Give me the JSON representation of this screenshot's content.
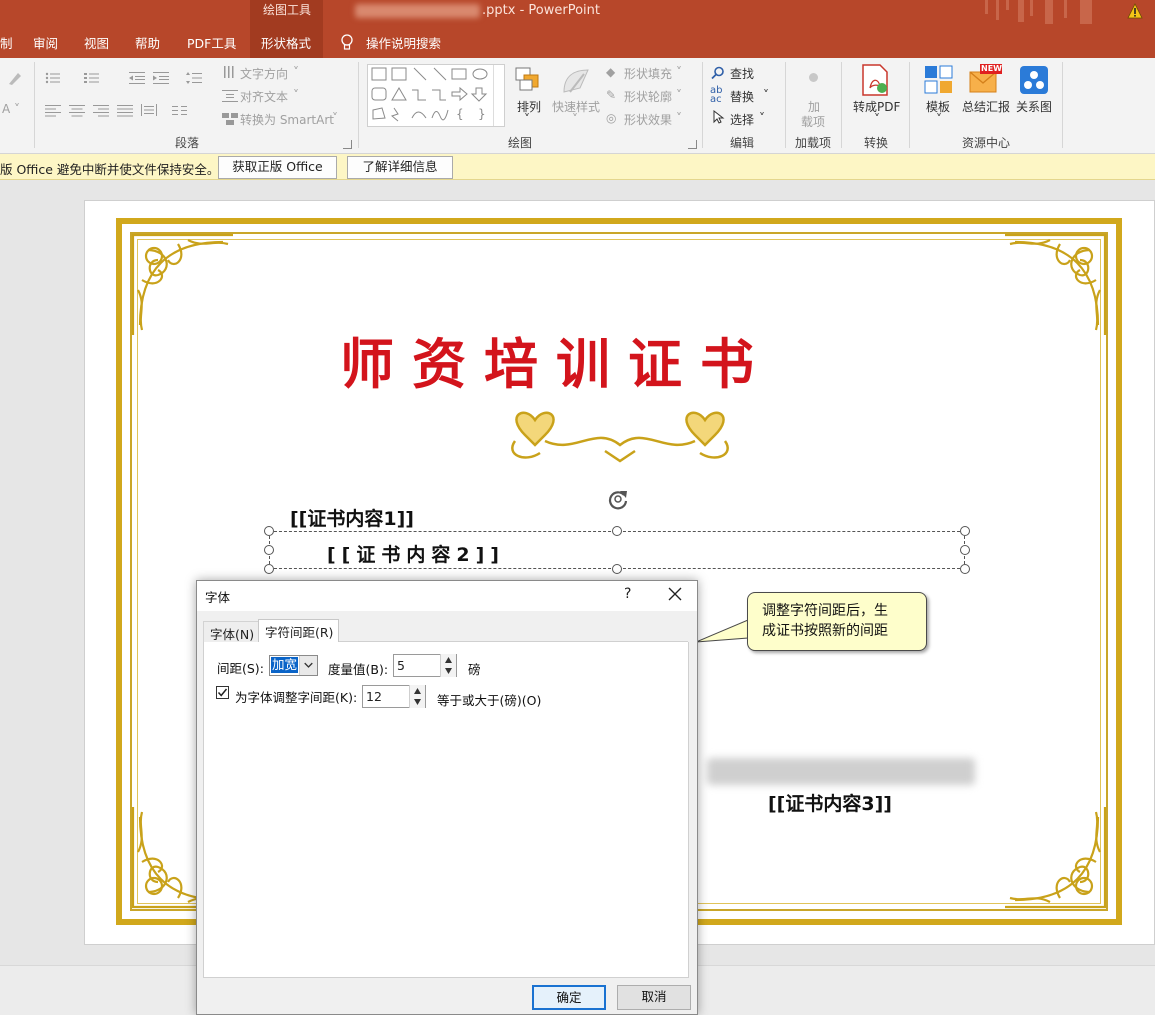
{
  "window": {
    "contextual_group": "绘图工具",
    "filename_suffix": ".pptx",
    "title_sep": "-",
    "app_name": "PowerPoint"
  },
  "tabs": {
    "draw_partial": "制",
    "review": "审阅",
    "view": "视图",
    "help": "帮助",
    "pdf_tools": "PDF工具",
    "shape_format": "形状格式",
    "tell_me": "操作说明搜索"
  },
  "ribbon": {
    "paragraph": {
      "text_direction": "文字方向",
      "align_text": "对齐文本",
      "convert_smartart": "转换为 SmartArt",
      "group_label": "段落"
    },
    "drawing": {
      "arrange": "排列",
      "quick_styles": "快速样式",
      "shape_fill": "形状填充",
      "shape_outline": "形状轮廓",
      "shape_effects": "形状效果",
      "group_label": "绘图"
    },
    "editing": {
      "find": "查找",
      "replace": "替换",
      "select": "选择",
      "group_label": "编辑"
    },
    "addins": {
      "label_line1": "加",
      "label_line2": "载项",
      "group_label": "加载项"
    },
    "convert": {
      "to_pdf": "转成PDF",
      "group_label": "转换"
    },
    "resources": {
      "templates": "模板",
      "summary_report": "总结汇报",
      "relationship": "关系图",
      "new_badge": "NEW",
      "group_label": "资源中心"
    }
  },
  "message_bar": {
    "text": "版 Office 避免中断并使文件保持安全。",
    "get_genuine": "获取正版 Office",
    "learn_more": "了解详细信息"
  },
  "slide": {
    "title": "师资培训证书",
    "field1": "[[证书内容1]]",
    "field2": "[[证书内容2]]",
    "field3": "[[证书内容3]]"
  },
  "callout": {
    "line1": "调整字符间距后，生",
    "line2": "成证书按照新的间距"
  },
  "dialog": {
    "title": "字体",
    "help": "?",
    "tabs": {
      "font": "字体(N)",
      "char_spacing": "字符间距(R)"
    },
    "spacing_label": "间距(S):",
    "spacing_value": "加宽",
    "by_label": "度量值(B):",
    "by_value": "5",
    "by_unit": "磅",
    "kerning_label": "为字体调整字间距(K):",
    "kerning_value": "12",
    "kerning_suffix": "等于或大于(磅)(O)",
    "ok": "确定",
    "cancel": "取消"
  },
  "colors": {
    "ribbon_red": "#b7472a",
    "gold": "#d1a81c",
    "title_red": "#d3141c"
  }
}
